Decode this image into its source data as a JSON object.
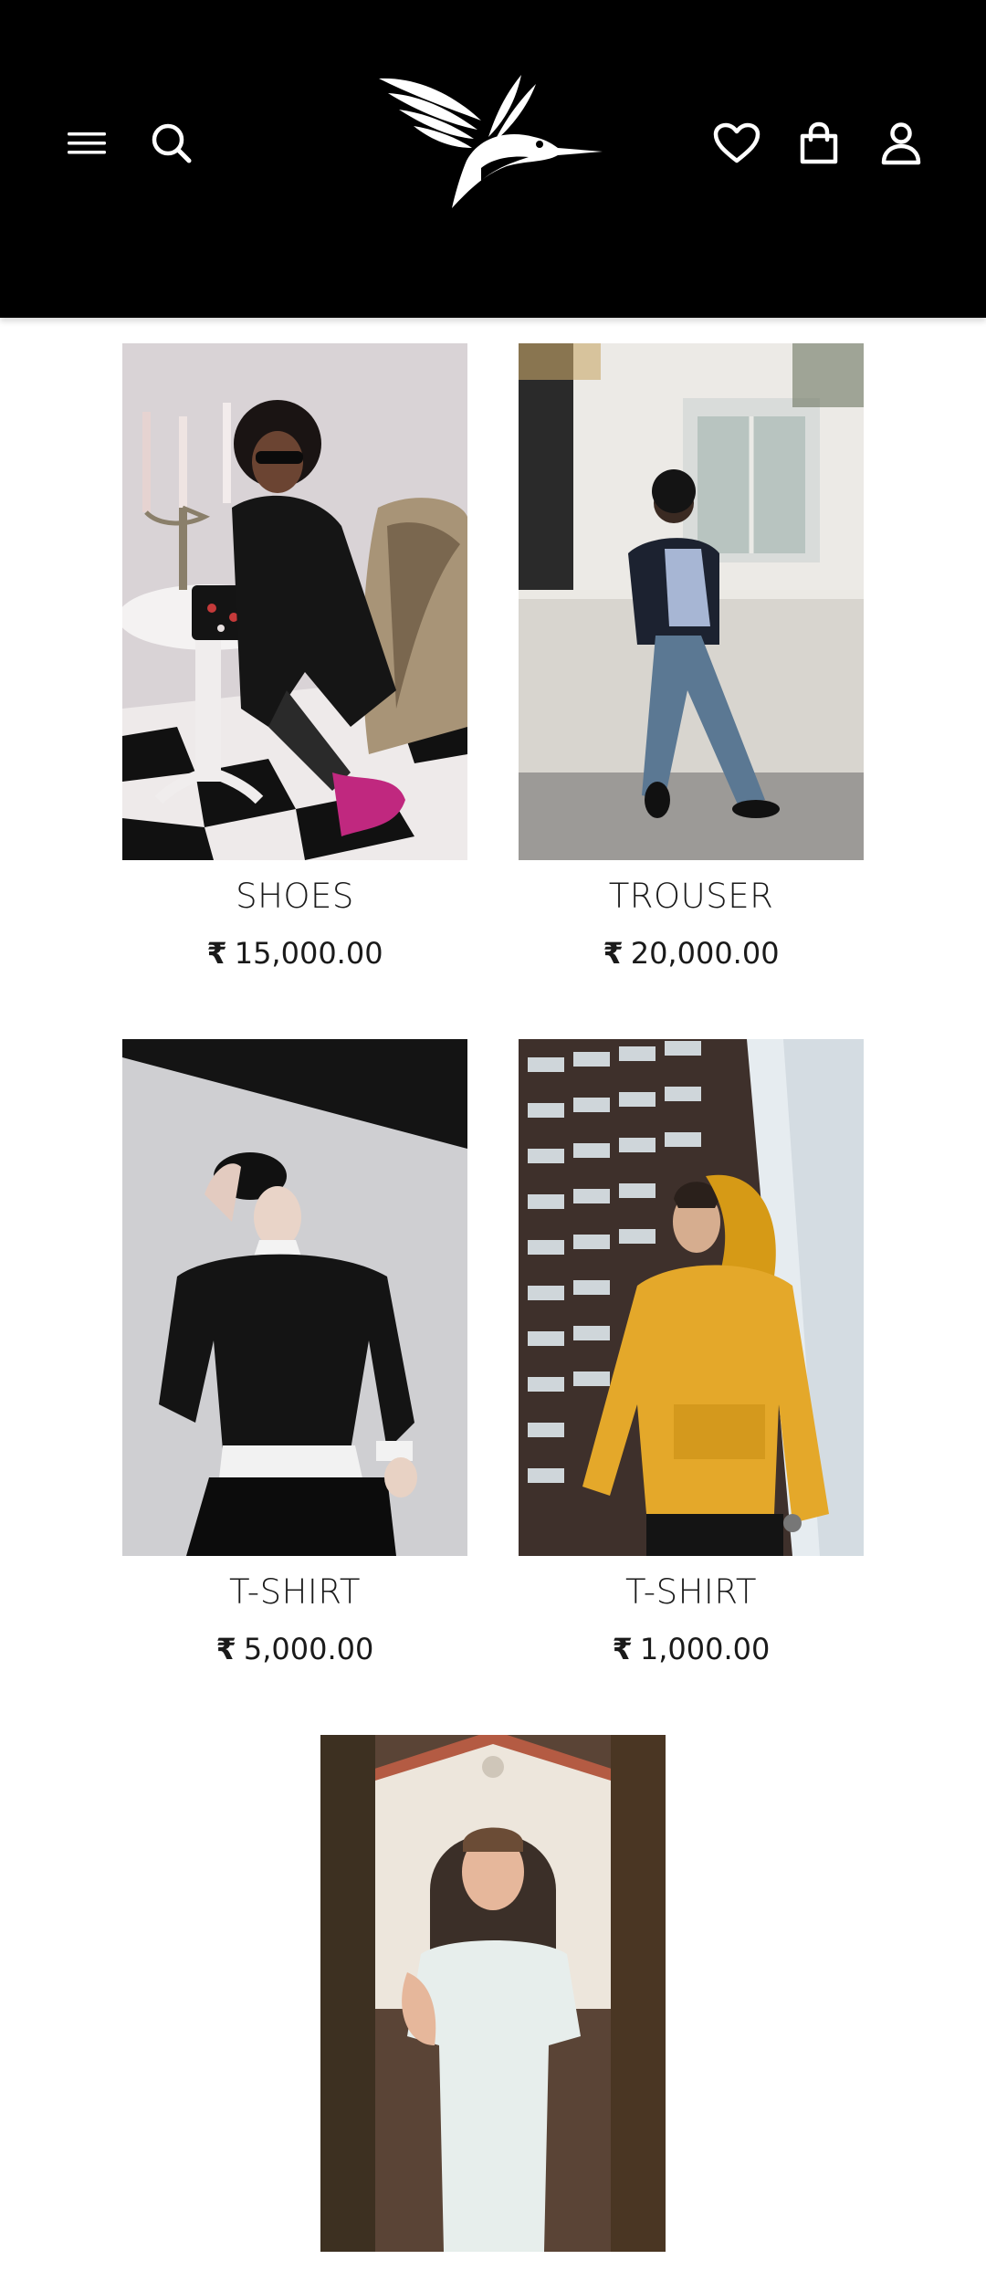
{
  "header": {
    "menu_icon": "hamburger-menu-icon",
    "search_icon": "search-icon",
    "logo": "hummingbird-logo",
    "wishlist_icon": "heart-icon",
    "bag_icon": "shopping-bag-icon",
    "account_icon": "user-icon",
    "background": "#000000",
    "icon_color": "#ffffff"
  },
  "products": [
    {
      "name": "SHOES",
      "currency": "₹",
      "price": "15,000.00"
    },
    {
      "name": "TROUSER",
      "currency": "₹",
      "price": "20,000.00"
    },
    {
      "name": "T-SHIRT",
      "currency": "₹",
      "price": "5,000.00"
    },
    {
      "name": "T-SHIRT",
      "currency": "₹",
      "price": "1,000.00"
    },
    {
      "name": "",
      "currency": "",
      "price": ""
    }
  ]
}
